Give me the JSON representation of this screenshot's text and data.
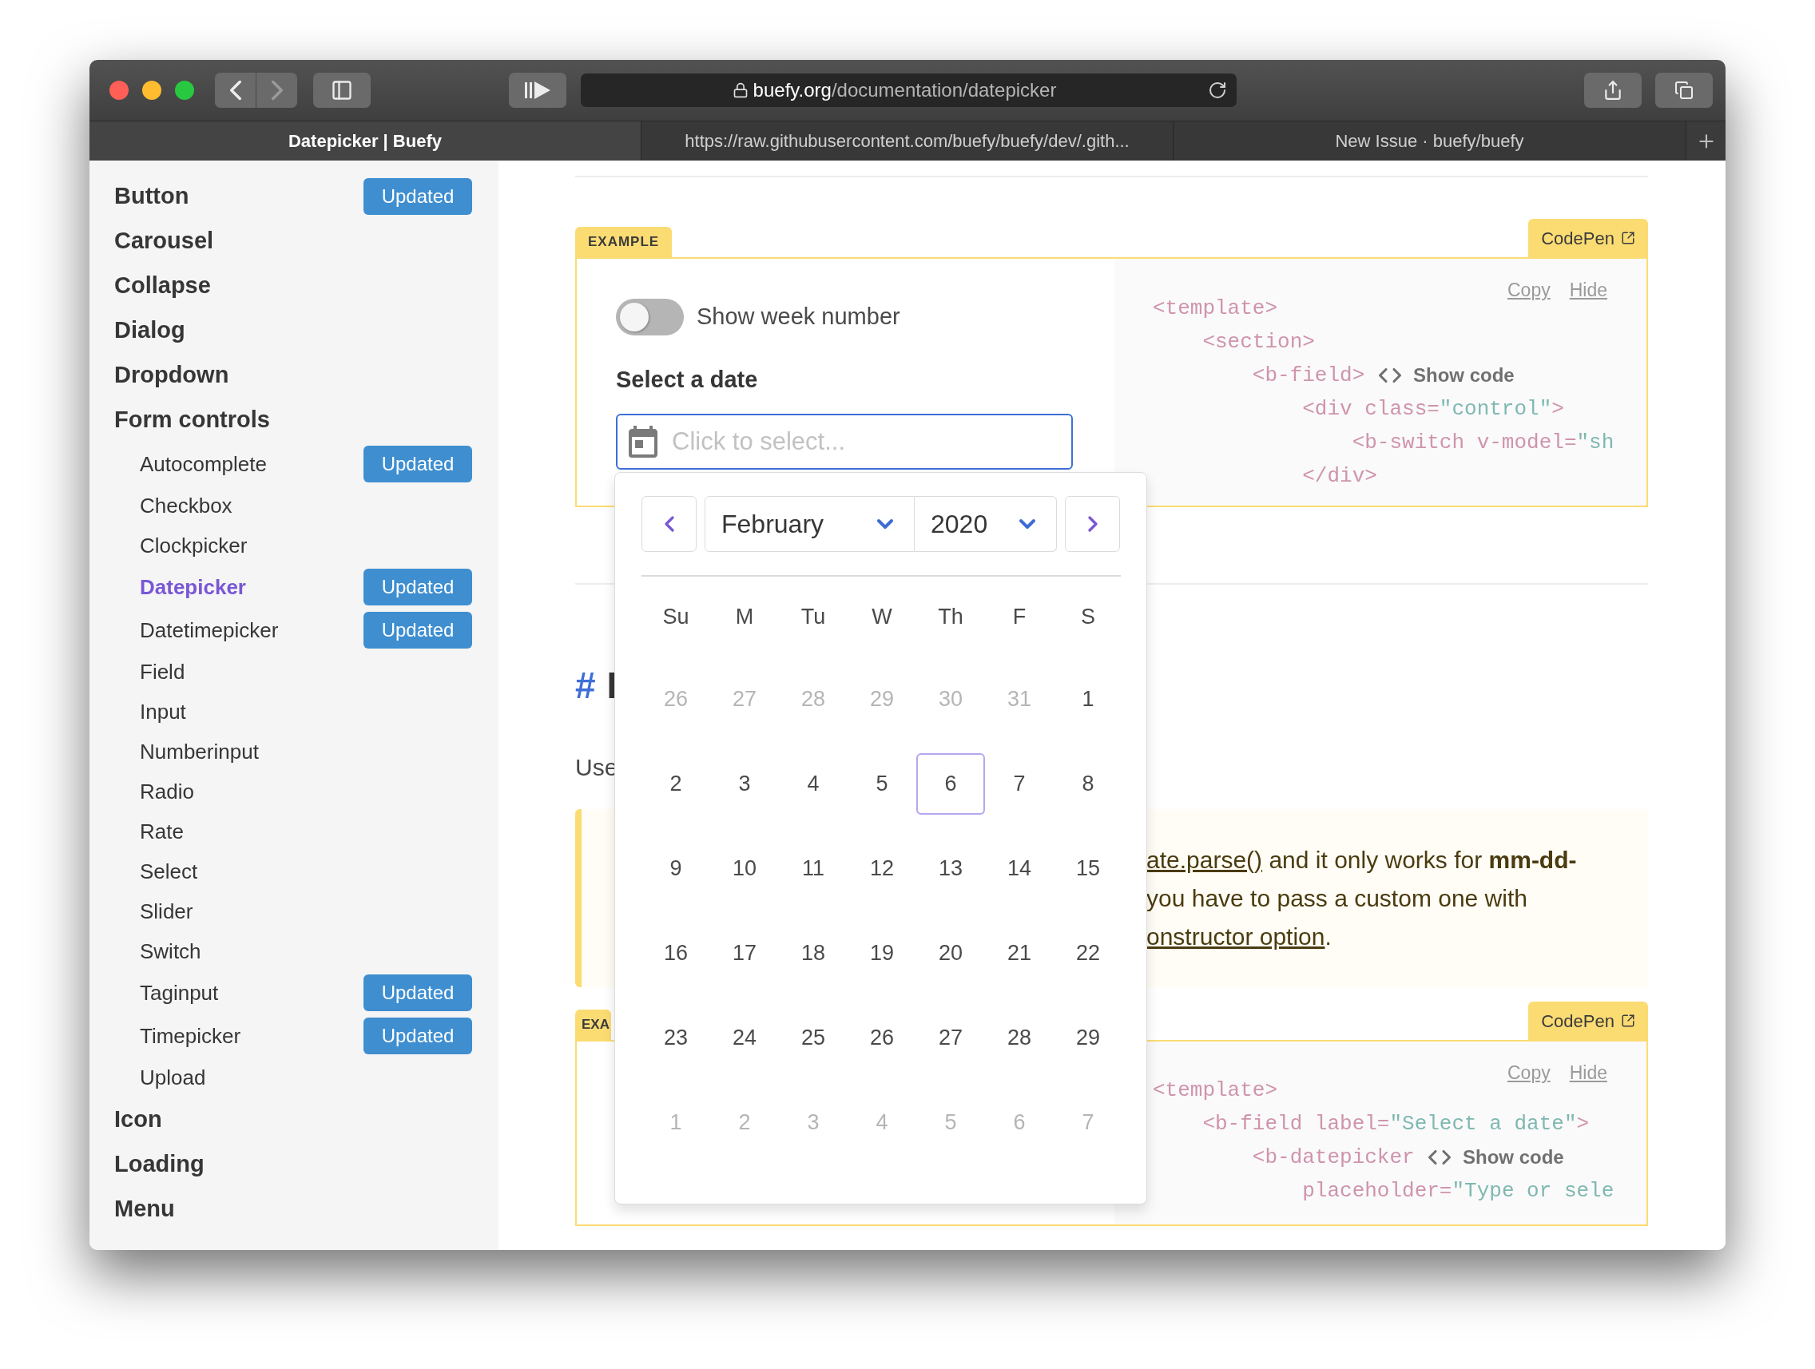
{
  "browser": {
    "url_host": "buefy.org",
    "url_path": "/documentation/datepicker",
    "tabs": [
      {
        "title": "Datepicker | Buefy",
        "selected": true
      },
      {
        "title": "https://raw.githubusercontent.com/buefy/buefy/dev/.gith...",
        "selected": false
      },
      {
        "title": "New Issue · buefy/buefy",
        "selected": false
      }
    ]
  },
  "sidebar": {
    "items": [
      {
        "label": "Button",
        "badge": "Updated",
        "selected": false
      },
      {
        "label": "Carousel",
        "selected": false
      },
      {
        "label": "Collapse",
        "selected": false
      },
      {
        "label": "Dialog",
        "selected": false
      },
      {
        "label": "Dropdown",
        "selected": false
      },
      {
        "label": "Form controls",
        "selected": false,
        "children": [
          {
            "label": "Autocomplete",
            "badge": "Updated",
            "selected": false
          },
          {
            "label": "Checkbox",
            "selected": false
          },
          {
            "label": "Clockpicker",
            "selected": false
          },
          {
            "label": "Datepicker",
            "badge": "Updated",
            "selected": true
          },
          {
            "label": "Datetimepicker",
            "badge": "Updated",
            "selected": false
          },
          {
            "label": "Field",
            "selected": false
          },
          {
            "label": "Input",
            "selected": false
          },
          {
            "label": "Numberinput",
            "selected": false
          },
          {
            "label": "Radio",
            "selected": false
          },
          {
            "label": "Rate",
            "selected": false
          },
          {
            "label": "Select",
            "selected": false
          },
          {
            "label": "Slider",
            "selected": false
          },
          {
            "label": "Switch",
            "selected": false
          },
          {
            "label": "Taginput",
            "badge": "Updated",
            "selected": false
          },
          {
            "label": "Timepicker",
            "badge": "Updated",
            "selected": false
          },
          {
            "label": "Upload",
            "selected": false
          }
        ]
      },
      {
        "label": "Icon",
        "selected": false
      },
      {
        "label": "Loading",
        "selected": false
      },
      {
        "label": "Menu",
        "selected": false
      }
    ]
  },
  "example": {
    "tag": "EXAMPLE",
    "codepen": "CodePen",
    "switch": {
      "label": "Show week number",
      "on": false
    },
    "field_label": "Select a date",
    "input": {
      "placeholder": "Click to select..."
    },
    "code": {
      "copy": "Copy",
      "hide": "Hide",
      "show_code": "Show code",
      "lines": [
        [
          {
            "text": "<template>",
            "kind": "tag"
          }
        ],
        [
          {
            "text": "    <section>",
            "kind": "tag"
          }
        ],
        [
          {
            "text": "        <b-field>",
            "kind": "tag"
          }
        ],
        [
          {
            "text": "            <div class=",
            "kind": "tag"
          },
          {
            "text": "\"control\"",
            "kind": "string"
          },
          {
            "text": ">",
            "kind": "tag"
          }
        ],
        [
          {
            "text": "                <b-switch v-model=",
            "kind": "tag"
          },
          {
            "text": "\"sh",
            "kind": "string"
          }
        ],
        [
          {
            "text": "            </div>",
            "kind": "tag"
          }
        ]
      ]
    }
  },
  "datepicker": {
    "month": "February",
    "year": "2020",
    "weekdays": [
      "Su",
      "M",
      "Tu",
      "W",
      "Th",
      "F",
      "S"
    ],
    "days": [
      {
        "day": "26",
        "outside": true,
        "today": false
      },
      {
        "day": "27",
        "outside": true,
        "today": false
      },
      {
        "day": "28",
        "outside": true,
        "today": false
      },
      {
        "day": "29",
        "outside": true,
        "today": false
      },
      {
        "day": "30",
        "outside": true,
        "today": false
      },
      {
        "day": "31",
        "outside": true,
        "today": false
      },
      {
        "day": "1",
        "outside": false,
        "today": false
      },
      {
        "day": "2",
        "outside": false,
        "today": false
      },
      {
        "day": "3",
        "outside": false,
        "today": false
      },
      {
        "day": "4",
        "outside": false,
        "today": false
      },
      {
        "day": "5",
        "outside": false,
        "today": false
      },
      {
        "day": "6",
        "outside": false,
        "today": true
      },
      {
        "day": "7",
        "outside": false,
        "today": false
      },
      {
        "day": "8",
        "outside": false,
        "today": false
      },
      {
        "day": "9",
        "outside": false,
        "today": false
      },
      {
        "day": "10",
        "outside": false,
        "today": false
      },
      {
        "day": "11",
        "outside": false,
        "today": false
      },
      {
        "day": "12",
        "outside": false,
        "today": false
      },
      {
        "day": "13",
        "outside": false,
        "today": false
      },
      {
        "day": "14",
        "outside": false,
        "today": false
      },
      {
        "day": "15",
        "outside": false,
        "today": false
      },
      {
        "day": "16",
        "outside": false,
        "today": false
      },
      {
        "day": "17",
        "outside": false,
        "today": false
      },
      {
        "day": "18",
        "outside": false,
        "today": false
      },
      {
        "day": "19",
        "outside": false,
        "today": false
      },
      {
        "day": "20",
        "outside": false,
        "today": false
      },
      {
        "day": "21",
        "outside": false,
        "today": false
      },
      {
        "day": "22",
        "outside": false,
        "today": false
      },
      {
        "day": "23",
        "outside": false,
        "today": false
      },
      {
        "day": "24",
        "outside": false,
        "today": false
      },
      {
        "day": "25",
        "outside": false,
        "today": false
      },
      {
        "day": "26",
        "outside": false,
        "today": false
      },
      {
        "day": "27",
        "outside": false,
        "today": false
      },
      {
        "day": "28",
        "outside": false,
        "today": false
      },
      {
        "day": "29",
        "outside": false,
        "today": false
      },
      {
        "day": "1",
        "outside": true,
        "today": false
      },
      {
        "day": "2",
        "outside": true,
        "today": false
      },
      {
        "day": "3",
        "outside": true,
        "today": false
      },
      {
        "day": "4",
        "outside": true,
        "today": false
      },
      {
        "day": "5",
        "outside": true,
        "today": false
      },
      {
        "day": "6",
        "outside": true,
        "today": false
      },
      {
        "day": "7",
        "outside": true,
        "today": false
      }
    ]
  },
  "section": {
    "anchor": "#",
    "title": "I",
    "intro": "Use"
  },
  "notice": {
    "lines": [
      [
        {
          "text": "ate.parse()",
          "kind": "link"
        },
        {
          "text": " and it only works for ",
          "kind": "text"
        },
        {
          "text": "mm-dd-",
          "kind": "bold"
        }
      ],
      [
        {
          "text": "you have to pass a custom one with",
          "kind": "text"
        }
      ],
      [
        {
          "text": "onstructor option",
          "kind": "link"
        },
        {
          "text": ".",
          "kind": "text"
        }
      ]
    ]
  },
  "example2": {
    "tag": "EXA",
    "codepen": "CodePen",
    "code": {
      "copy": "Copy",
      "hide": "Hide",
      "show_code": "Show code",
      "lines": [
        [
          {
            "text": "<template>",
            "kind": "tag"
          }
        ],
        [
          {
            "text": "    <b-field label=",
            "kind": "tag"
          },
          {
            "text": "\"Select a date\"",
            "kind": "string"
          },
          {
            "text": ">",
            "kind": "tag"
          }
        ],
        [
          {
            "text": "        <b-datepicker",
            "kind": "tag"
          }
        ],
        [
          {
            "text": "            placeholder=",
            "kind": "tag"
          },
          {
            "text": "\"Type or sele",
            "kind": "string"
          }
        ]
      ]
    }
  }
}
